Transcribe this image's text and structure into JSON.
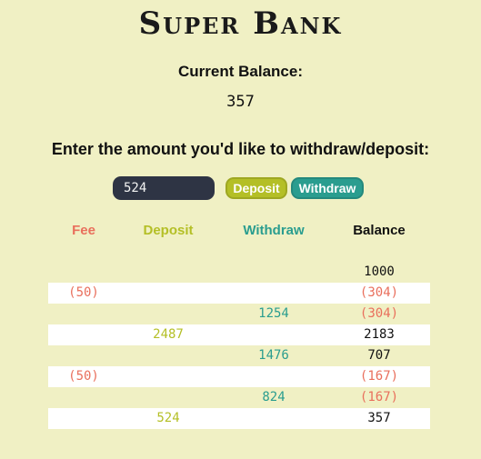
{
  "app": {
    "title": "Super Bank"
  },
  "balance": {
    "label": "Current Balance:",
    "value": "357"
  },
  "transaction": {
    "prompt": "Enter the amount you'd like to withdraw/deposit:",
    "input_value": "524",
    "deposit_label": "Deposit",
    "withdraw_label": "Withdraw"
  },
  "ledger": {
    "headers": {
      "fee": "Fee",
      "deposit": "Deposit",
      "withdraw": "Withdraw",
      "balance": "Balance"
    },
    "rows": [
      {
        "fee": "",
        "deposit": "",
        "withdraw": "",
        "balance": "1000",
        "balance_negative": false
      },
      {
        "fee": "(50)",
        "deposit": "",
        "withdraw": "",
        "balance": "(304)",
        "balance_negative": true
      },
      {
        "fee": "",
        "deposit": "",
        "withdraw": "1254",
        "balance": "(304)",
        "balance_negative": true
      },
      {
        "fee": "",
        "deposit": "2487",
        "withdraw": "",
        "balance": "2183",
        "balance_negative": false
      },
      {
        "fee": "",
        "deposit": "",
        "withdraw": "1476",
        "balance": "707",
        "balance_negative": false
      },
      {
        "fee": "(50)",
        "deposit": "",
        "withdraw": "",
        "balance": "(167)",
        "balance_negative": true
      },
      {
        "fee": "",
        "deposit": "",
        "withdraw": "824",
        "balance": "(167)",
        "balance_negative": true
      },
      {
        "fee": "",
        "deposit": "524",
        "withdraw": "",
        "balance": "357",
        "balance_negative": false
      }
    ]
  },
  "colors": {
    "background": "#f0f0c4",
    "fee": "#e96f5c",
    "deposit": "#b4bf26",
    "withdraw": "#2a9d8f",
    "input_bg": "#2e3444"
  }
}
